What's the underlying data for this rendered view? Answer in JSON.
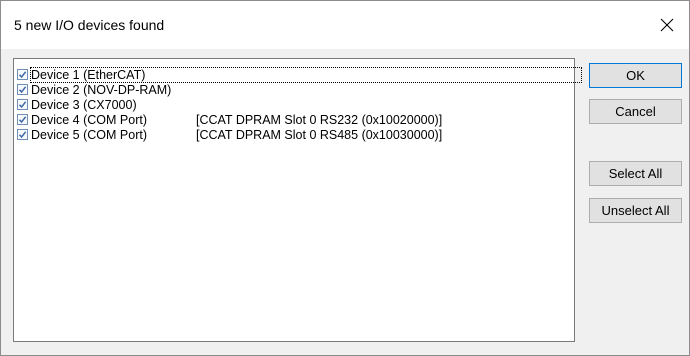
{
  "dialog": {
    "title": "5 new I/O devices found",
    "close_icon": "close-icon"
  },
  "devices": [
    {
      "name": "Device 1 (EtherCAT)",
      "detail": "",
      "checked": true
    },
    {
      "name": "Device 2 (NOV-DP-RAM)",
      "detail": "",
      "checked": true
    },
    {
      "name": "Device 3 (CX7000)",
      "detail": "",
      "checked": true
    },
    {
      "name": "Device 4 (COM Port)",
      "detail": "[CCAT DPRAM Slot 0 RS232 (0x10020000)]",
      "checked": true
    },
    {
      "name": "Device 5 (COM Port)",
      "detail": "[CCAT DPRAM Slot 0 RS485 (0x10030000)]",
      "checked": true
    }
  ],
  "buttons": {
    "ok": "OK",
    "cancel": "Cancel",
    "select_all": "Select All",
    "unselect_all": "Unselect All"
  },
  "colors": {
    "accent": "#0078d7",
    "check": "#3c6aa8"
  }
}
